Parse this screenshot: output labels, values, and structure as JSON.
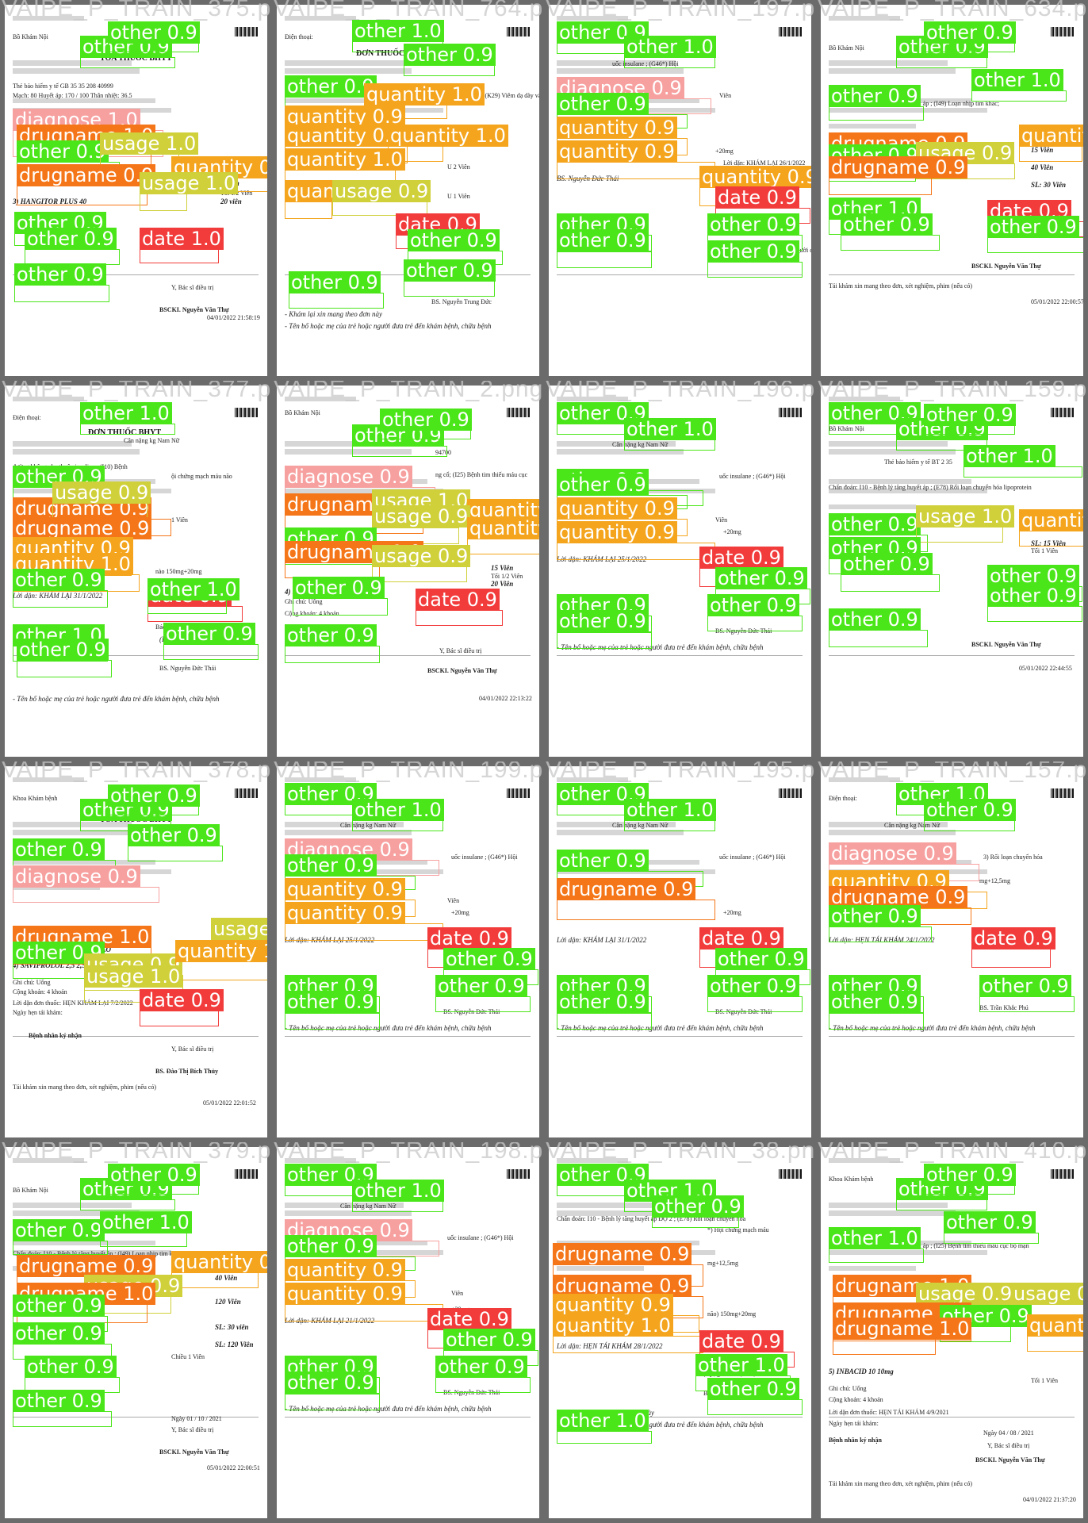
{
  "tiles": [
    {
      "title": "VAIPE_P_TRAIN_375.png",
      "texts": [
        "Bồ Khám Nội",
        "TOA THUỐC BHYT",
        "Thẻ bảo hiểm y tế  GB  35  35  208  40999",
        "Mạch: 80  Huyết áp: 170 / 100  Thân nhiệt: 36.5",
        "3) HANGITOR PLUS 40",
        "5 Viên",
        "20 viên",
        "Tối 1/2 Viên",
        "Y, Bác sĩ điều trị",
        "BSCKI. Nguyễn Văn Thự",
        "04/01/2022 21:58:19"
      ],
      "dets": [
        {
          "label": "other 0.9"
        },
        {
          "label": "other 0.9"
        },
        {
          "label": "diagnose 1.0"
        },
        {
          "label": "drugname 1.0"
        },
        {
          "label": "other 0.9"
        },
        {
          "label": "usage 1.0"
        },
        {
          "label": "quantity 0.9"
        },
        {
          "label": "drugname 0.9"
        },
        {
          "label": "usage 1.0"
        },
        {
          "label": "other 0.9"
        },
        {
          "label": "other 0.9"
        },
        {
          "label": "date 1.0"
        },
        {
          "label": "other 0.9"
        }
      ]
    },
    {
      "title": "VAIPE_P_TRAIN_764.png",
      "texts": [
        "Điện thoại:",
        "ĐƠN THUỐC BHYT",
        "m ; (K29) Viêm dạ dày và",
        "U 2 Viên",
        "U 1 Viên",
        "(Ký, ghi rõ họ tên)",
        "BS. Nguyễn Trung Đức",
        "- Khám lại xin mang theo đơn này",
        "- Tên bố hoặc mẹ của trẻ hoặc người đưa trẻ đến khám bệnh, chữa bệnh"
      ],
      "dets": [
        {
          "label": "other 1.0"
        },
        {
          "label": "other 0.9"
        },
        {
          "label": "other 0.9"
        },
        {
          "label": "quantity 1.0"
        },
        {
          "label": "quantity 0.9"
        },
        {
          "label": "quantity 0.9"
        },
        {
          "label": "quantity 1.0"
        },
        {
          "label": "quantity 1.0"
        },
        {
          "label": "quantity 0.9"
        },
        {
          "label": "usage 0.9"
        },
        {
          "label": "date 0.9"
        },
        {
          "label": "other 0.9"
        },
        {
          "label": "other 0.9"
        },
        {
          "label": "other 0.9"
        }
      ]
    },
    {
      "title": "VAIPE_P_TRAIN_197.png",
      "texts": [
        "ĐƠN THUỐC BHYT",
        "Cân nặng  kg  Nam  Nữ",
        "uốc insulane ; (G46*) Hội",
        "Viên",
        "+20mg",
        "Lời dặn: KHÁM LẠI 26/1/2022",
        "BS. Nguyễn Đức Thái",
        "- Tên bố hoặc mẹ của trẻ hoặc người đưa trẻ đến khám bệnh, chữa bệnh"
      ],
      "dets": [
        {
          "label": "other 0.9"
        },
        {
          "label": "other 1.0"
        },
        {
          "label": "diagnose 0.9"
        },
        {
          "label": "other 0.9"
        },
        {
          "label": "quantity 0.9"
        },
        {
          "label": "quantity 0.9"
        },
        {
          "label": "quantity 0.9"
        },
        {
          "label": "date 0.9"
        },
        {
          "label": "other 0.9"
        },
        {
          "label": "other 0.9"
        },
        {
          "label": "other 0.9"
        },
        {
          "label": "other 0.9"
        }
      ]
    },
    {
      "title": "VAIPE_P_TRAIN_634.png",
      "texts": [
        "Bồ Khám Nội",
        "Chẩn đoán: I10 - Bệnh lý tăng huyết áp ; (I49) Loạn nhịp tim khác;",
        "15 Viên",
        "40 Viên",
        "SL: 30 Viên",
        "BSCKI. Nguyễn Văn Thự",
        "Tái khám xin mang theo đơn, xét nghiệm, phim (nếu có)",
        "05/01/2022 22:00:57"
      ],
      "dets": [
        {
          "label": "other 0.9"
        },
        {
          "label": "other 0.9"
        },
        {
          "label": "other 1.0"
        },
        {
          "label": "other 0.9"
        },
        {
          "label": "drugname 0.9"
        },
        {
          "label": "quantity 0.9"
        },
        {
          "label": "other 0.9"
        },
        {
          "label": "usage 0.9"
        },
        {
          "label": "drugname 0.9"
        },
        {
          "label": "other 1.0"
        },
        {
          "label": "other 0.9"
        },
        {
          "label": "date 0.9"
        },
        {
          "label": "other 0.9"
        }
      ]
    },
    {
      "title": "VAIPE_P_TRAIN_377.png",
      "texts": [
        "Điện thoại:",
        "ĐƠN THUỐC BHYT",
        "Cân nặng  kg  Nam  Nữ",
        "đường không phụ thuộc insuline ; (I10) Bệnh",
        "ội chứng mạch máu não",
        "1 Viên",
        "nào 150mg+20mg",
        "Lời dặn: KHÁM LẠI 31/1/2022",
        "Bác sỹ/Y sỹ khám bệnh",
        "(Ký, ghi rõ họ tên)",
        "BS. Nguyễn Đức Thái",
        "- Tên bố hoặc mẹ của trẻ hoặc người đưa trẻ đến khám bệnh, chữa bệnh"
      ],
      "dets": [
        {
          "label": "other 1.0"
        },
        {
          "label": "other 0.9"
        },
        {
          "label": "drugname 0.9"
        },
        {
          "label": "usage 0.9"
        },
        {
          "label": "drugname 0.9"
        },
        {
          "label": "quantity 0.9"
        },
        {
          "label": "quantity 1.0"
        },
        {
          "label": "other 0.9"
        },
        {
          "label": "date 0.9"
        },
        {
          "label": "other 1.0"
        },
        {
          "label": "other 0.9"
        },
        {
          "label": "other 1.0"
        },
        {
          "label": "other 0.9"
        }
      ]
    },
    {
      "title": "VAIPE_P_TRAIN_2.png",
      "texts": [
        "Bồ Khám Nội",
        "TOA THUỐC BHYT",
        "94700",
        "ng cổ; (I25) Bệnh tim thiếu máu cục",
        "4) PARTAMOL TAB. 500",
        "15 Viên",
        "20 Viên",
        "Tối 1/2 Viên",
        "Ghi chú:  Uống",
        "Cộng khoản: 4  khoản",
        "Y, Bác sĩ điều trị",
        "BSCKI. Nguyễn Văn Thự",
        "04/01/2022 22:13:22"
      ],
      "dets": [
        {
          "label": "other 0.9"
        },
        {
          "label": "other 0.9"
        },
        {
          "label": "diagnose 0.9"
        },
        {
          "label": "drugname 1.0"
        },
        {
          "label": "usage 1.0"
        },
        {
          "label": "quantity 0.9"
        },
        {
          "label": "usage 0.9"
        },
        {
          "label": "quantity 0.9"
        },
        {
          "label": "other 0.9"
        },
        {
          "label": "drugname 1.0"
        },
        {
          "label": "usage 0.9"
        },
        {
          "label": "other 0.9"
        },
        {
          "label": "date 0.9"
        },
        {
          "label": "other 0.9"
        }
      ]
    },
    {
      "title": "VAIPE_P_TRAIN_196.png",
      "texts": [
        "ĐƠN THUỐC BHYT",
        "Cân nặng  kg  Nam  Nữ",
        "uốc insulane ; (G46*) Hội",
        "Viên",
        "+20mg",
        "Lời dặn: KHÁM LẠI 25/1/2022",
        "BS. Nguyễn Đức Thái",
        "- Tên bố hoặc mẹ của trẻ hoặc người đưa trẻ đến khám bệnh, chữa bệnh"
      ],
      "dets": [
        {
          "label": "other 0.9"
        },
        {
          "label": "other 1.0"
        },
        {
          "label": "other 0.9"
        },
        {
          "label": "other 0.9"
        },
        {
          "label": "quantity 0.9"
        },
        {
          "label": "quantity 0.9"
        },
        {
          "label": "date 0.9"
        },
        {
          "label": "other 0.9"
        },
        {
          "label": "other 0.9"
        },
        {
          "label": "other 0.9"
        },
        {
          "label": "other 0.9"
        }
      ]
    },
    {
      "title": "VAIPE_P_TRAIN_159.png",
      "texts": [
        "Bồ Khám Nội",
        "Thẻ bảo hiểm y tế  BT  2  35",
        "Chẩn đoán: I10 - Bệnh lý tăng huyết áp ; (E78) Rối loạn chuyển hóa lipoprotein",
        "30 Viên",
        "SL: 15 Viên",
        "Tối 1 Viên",
        "2) ATORIS 20MG 20mg",
        "BSCKI. Nguyễn Văn Thự",
        "05/01/2022 22:44:55"
      ],
      "dets": [
        {
          "label": "other 0.9"
        },
        {
          "label": "other 0.9"
        },
        {
          "label": "other 0.9"
        },
        {
          "label": "other 1.0"
        },
        {
          "label": "other 0.9"
        },
        {
          "label": "usage 1.0"
        },
        {
          "label": "quantity 0.9"
        },
        {
          "label": "other 0.9"
        },
        {
          "label": "other 0.9"
        },
        {
          "label": "other 0.9"
        },
        {
          "label": "other 0.9"
        },
        {
          "label": "other 0.9"
        }
      ]
    },
    {
      "title": "VAIPE_P_TRAIN_378.png",
      "texts": [
        "Khoa Khám bệnh",
        "TOA THUỐC BHYT",
        "3) HOẠT HUYẾT DƯỠNG NÃO",
        "4) SAVIPROLOL 2,5 2,5mg",
        "Ghi chú:  Uống",
        "Cộng khoản: 4  khoản",
        "Lời dặn đơn thuốc: HẸN KHÁM LẠI 7/2/2022",
        "Ngày hẹn tái khám:",
        "Bệnh nhân ký nhận",
        "Y, Bác sĩ điều trị",
        "BS. Đào Thị Bích Thủy",
        "Tái khám xin mang theo đơn, xét nghiệm, phim (nếu có)",
        "05/01/2022 22:01:52"
      ],
      "dets": [
        {
          "label": "other 0.9"
        },
        {
          "label": "other 0.9"
        },
        {
          "label": "other 0.9"
        },
        {
          "label": "other 0.9"
        },
        {
          "label": "diagnose 0.9"
        },
        {
          "label": "drugname 1.0"
        },
        {
          "label": "other 0.9"
        },
        {
          "label": "usage 0.9"
        },
        {
          "label": "usage 0.9"
        },
        {
          "label": "quantity 1.0"
        },
        {
          "label": "usage 1.0"
        },
        {
          "label": "date 0.9"
        }
      ]
    },
    {
      "title": "VAIPE_P_TRAIN_199.png",
      "texts": [
        "ĐƠN THUỐC BHYT",
        "Cân nặng  kg  Nam  Nữ",
        "uốc insulane ; (G46*) Hội",
        "Viên",
        "+20mg",
        "Lời dặn: KHÁM LẠI 25/1/2022",
        "BS. Nguyễn Đức Thái",
        "- Tên bố hoặc mẹ của trẻ hoặc người đưa trẻ đến khám bệnh, chữa bệnh"
      ],
      "dets": [
        {
          "label": "other 0.9"
        },
        {
          "label": "other 1.0"
        },
        {
          "label": "diagnose 0.9"
        },
        {
          "label": "other 0.9"
        },
        {
          "label": "quantity 0.9"
        },
        {
          "label": "quantity 0.9"
        },
        {
          "label": "date 0.9"
        },
        {
          "label": "other 0.9"
        },
        {
          "label": "other 0.9"
        },
        {
          "label": "other 0.9"
        },
        {
          "label": "other 0.9"
        }
      ]
    },
    {
      "title": "VAIPE_P_TRAIN_195.png",
      "texts": [
        "ĐƠN THUỐC BHYT",
        "Cân nặng  kg  Nam  Nữ",
        "uốc insulane ; (G46*) Hội",
        "+20mg",
        "Lời dặn: KHÁM LẠI 31/1/2022",
        "BS. Nguyễn Đức Thái",
        "- Tên bố hoặc mẹ của trẻ hoặc người đưa trẻ đến khám bệnh, chữa bệnh"
      ],
      "dets": [
        {
          "label": "other 0.9"
        },
        {
          "label": "other 1.0"
        },
        {
          "label": "other 0.9"
        },
        {
          "label": "drugname 0.9"
        },
        {
          "label": "date 0.9"
        },
        {
          "label": "other 0.9"
        },
        {
          "label": "other 0.9"
        },
        {
          "label": "other 0.9"
        },
        {
          "label": "other 0.9"
        }
      ]
    },
    {
      "title": "VAIPE_P_TRAIN_157.png",
      "texts": [
        "Điện thoại:",
        "Cân nặng  kg  Nam  Nữ",
        "3) Rối loạn chuyển hóa",
        "mg+12,5mg",
        "Lời dặn: HẸN TÁI KHÁM 24/1/2022",
        "BS. Trần Khắc Phú",
        "- Tên bố hoặc mẹ của trẻ hoặc người đưa trẻ đến khám bệnh, chữa bệnh"
      ],
      "dets": [
        {
          "label": "other 1.0"
        },
        {
          "label": "other 0.9"
        },
        {
          "label": "diagnose 0.9"
        },
        {
          "label": "quantity 0.9"
        },
        {
          "label": "drugname 0.9"
        },
        {
          "label": "other 0.9"
        },
        {
          "label": "date 0.9"
        },
        {
          "label": "other 0.9"
        },
        {
          "label": "other 0.9"
        },
        {
          "label": "other 0.9"
        }
      ]
    },
    {
      "title": "VAIPE_P_TRAIN_379.png",
      "texts": [
        "Bồ Khám Nội",
        "Chẩn đoán: I10 - Bệnh lý tăng huyết áp ; (I49) Loạn nhịp tim khác; (G46*) Hội chứng mạch máu não",
        "40 Viên",
        "120 Viên",
        "SL: 30 viên",
        "SL: 120 Viên",
        "Chiều 1 Viên",
        "Ngày 01 / 10 / 2021",
        "Y, Bác sĩ điều trị",
        "BSCKI. Nguyễn Văn Thự",
        "05/01/2022 22:00:51"
      ],
      "dets": [
        {
          "label": "other 0.9"
        },
        {
          "label": "other 0.9"
        },
        {
          "label": "other 0.9"
        },
        {
          "label": "other 1.0"
        },
        {
          "label": "drugname 0.9"
        },
        {
          "label": "quantity 0.9"
        },
        {
          "label": "usage 0.9"
        },
        {
          "label": "drugname 1.0"
        },
        {
          "label": "other 0.9"
        },
        {
          "label": "other 0.9"
        },
        {
          "label": "other 0.9"
        },
        {
          "label": "other 0.9"
        }
      ]
    },
    {
      "title": "VAIPE_P_TRAIN_198.png",
      "texts": [
        "ĐƠN THUỐC BHYT",
        "Cân nặng  kg  Nam  Nữ",
        "uốc insulane ; (G46*) Hội",
        "Viên",
        "+20mg",
        "Lời dặn: KHÁM LẠI 21/1/2022",
        "BS. Nguyễn Đức Thái",
        "- Tên bố hoặc mẹ của trẻ hoặc người đưa trẻ đến khám bệnh, chữa bệnh"
      ],
      "dets": [
        {
          "label": "other 0.9"
        },
        {
          "label": "other 1.0"
        },
        {
          "label": "diagnose 0.9"
        },
        {
          "label": "other 0.9"
        },
        {
          "label": "quantity 0.9"
        },
        {
          "label": "quantity 0.9"
        },
        {
          "label": "date 0.9"
        },
        {
          "label": "other 0.9"
        },
        {
          "label": "other 0.9"
        },
        {
          "label": "other 0.9"
        },
        {
          "label": "other 0.9"
        }
      ]
    },
    {
      "title": "VAIPE_P_TRAIN_38.png",
      "texts": [
        "ĐƠN THUỐC BHYT",
        "Chẩn đoán: I10 - Bệnh lý tăng huyết áp ĐỘ 2 ; (E78) Rối loạn chuyển hóa",
        "*) Hội chứng mạch máu",
        "mg+12,5mg",
        "não) 150mg+20mg",
        "Lời dặn: HẸN TÁI KHÁM 28/1/2022",
        "Bác sỹ/Y sỹ khám bệnh",
        "(Ký, ghi rõ họ tên)",
        "BSCKI. Nguyễn Văn Thự",
        "- Khám lại xin mang theo đơn này",
        "- Tên bố hoặc mẹ của trẻ hoặc người đưa trẻ đến khám bệnh, chữa bệnh"
      ],
      "dets": [
        {
          "label": "other 0.9"
        },
        {
          "label": "other 1.0"
        },
        {
          "label": "other 0.9"
        },
        {
          "label": "drugname 0.9"
        },
        {
          "label": "drugname 0.9"
        },
        {
          "label": "quantity 0.9"
        },
        {
          "label": "quantity 1.0"
        },
        {
          "label": "date 0.9"
        },
        {
          "label": "other 1.0"
        },
        {
          "label": "other 0.9"
        },
        {
          "label": "other 1.0"
        }
      ]
    },
    {
      "title": "VAIPE_P_TRAIN_410.png",
      "texts": [
        "Khoa Khám bệnh",
        "Chẩn đoán: I10 - Bệnh lý tăng huyết áp ; (I25) Bệnh tim thiếu máu cục bộ mạn",
        "5) INBACID 10 10mg",
        "Tối 1 Viên",
        "Ghi chú:  Uống",
        "Cộng khoản: 4  khoản",
        "Lời dặn đơn thuốc: HẸN TÁI KHÁM 4/9/2021",
        "Ngày hẹn tái khám:",
        "Bệnh nhân ký nhận",
        "Ngày 04 / 08 / 2021",
        "Y, Bác sĩ điều trị",
        "BSCKI. Nguyễn Văn Thự",
        "Tái khám xin mang theo đơn, xét nghiệm, phim (nếu có)",
        "04/01/2022 21:37:20"
      ],
      "dets": [
        {
          "label": "other 0.9"
        },
        {
          "label": "other 0.9"
        },
        {
          "label": "other 0.9"
        },
        {
          "label": "other 1.0"
        },
        {
          "label": "drugname 1.0"
        },
        {
          "label": "usage 0.9"
        },
        {
          "label": "usage 0.9"
        },
        {
          "label": "drugname 0.9"
        },
        {
          "label": "other 0.9"
        },
        {
          "label": "drugname 1.0"
        },
        {
          "label": "quantity 0.9"
        }
      ]
    }
  ]
}
